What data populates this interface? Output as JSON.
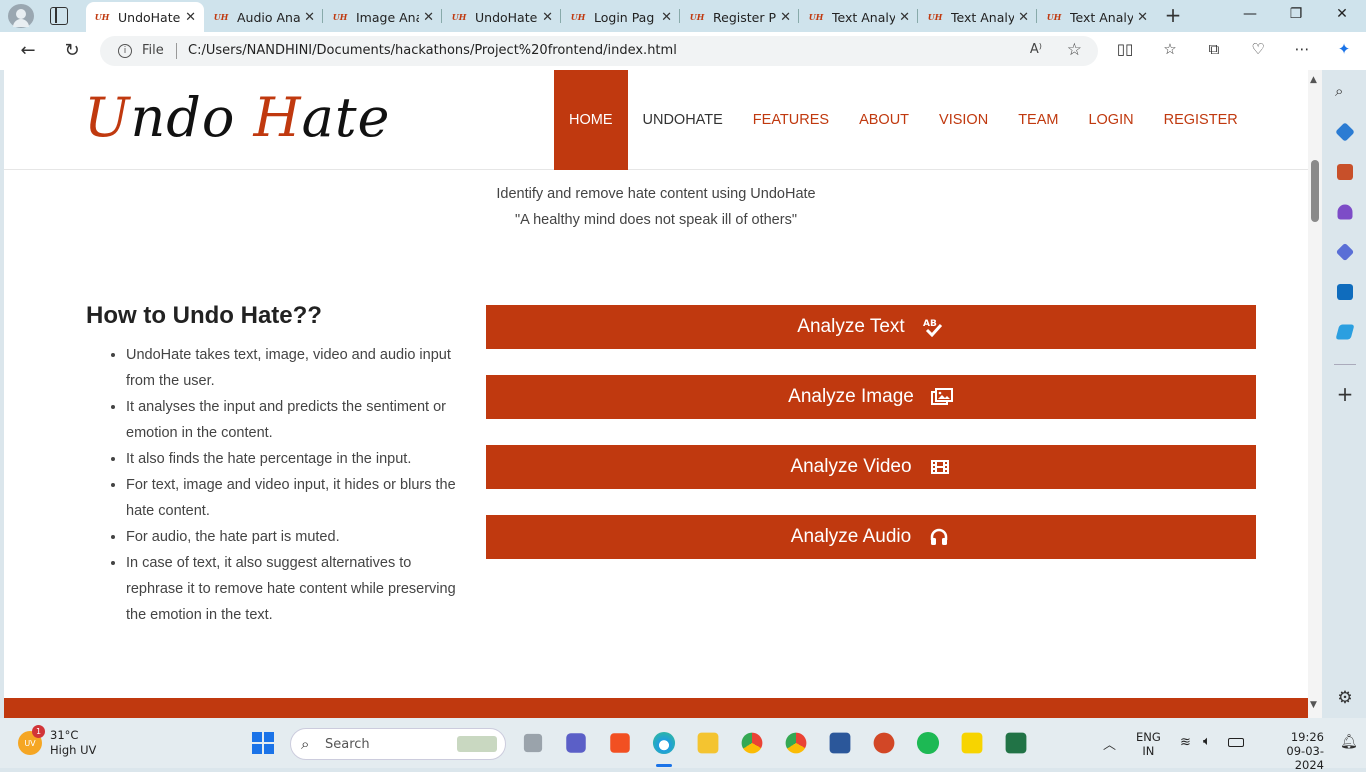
{
  "browser": {
    "tabs": [
      {
        "label": "UndoHate",
        "active": true
      },
      {
        "label": "Audio Ana",
        "active": false
      },
      {
        "label": "Image Ana",
        "active": false
      },
      {
        "label": "UndoHate",
        "active": false
      },
      {
        "label": "Login Pag",
        "active": false
      },
      {
        "label": "Register P",
        "active": false
      },
      {
        "label": "Text Analy",
        "active": false
      },
      {
        "label": "Text Analy",
        "active": false
      },
      {
        "label": "Text Analy",
        "active": false
      }
    ],
    "favicon_text": "UH",
    "address_scheme": "File",
    "address": "C:/Users/NANDHINI/Documents/hackathons/Project%20frontend/index.html",
    "read_aloud": "A⁾"
  },
  "site": {
    "logo_first": "U",
    "logo_first_rest": "ndo ",
    "logo_second": "H",
    "logo_second_rest": "ate",
    "nav": [
      "HOME",
      "UNDOHATE",
      "FEATURES",
      "ABOUT",
      "VISION",
      "TEAM",
      "LOGIN",
      "REGISTER"
    ],
    "tagline": "Identify and remove hate content using UndoHate",
    "quote": "\"A healthy mind does not speak ill of others\"",
    "howto_title": "How to Undo Hate??",
    "steps": [
      "UndoHate takes text, image, video and audio input from the user.",
      "It analyses the input and predicts the sentiment or emotion in the content.",
      "It also finds the hate percentage in the input.",
      "For text, image and video input, it hides or blurs the hate content.",
      "For audio, the hate part is muted.",
      "In case of text, it also suggest alternatives to rephrase it to remove hate content while preserving the emotion in the text."
    ],
    "buttons": {
      "text": "Analyze Text",
      "image": "Analyze Image",
      "video": "Analyze Video",
      "audio": "Analyze Audio"
    },
    "accent": "#c0390f"
  },
  "taskbar": {
    "temp": "31°C",
    "condition": "High UV",
    "weather_badge": "1",
    "weather_icon": "UV",
    "search_placeholder": "Search",
    "lang1": "ENG",
    "lang2": "IN",
    "time": "19:26",
    "date": "09-03-2024"
  }
}
